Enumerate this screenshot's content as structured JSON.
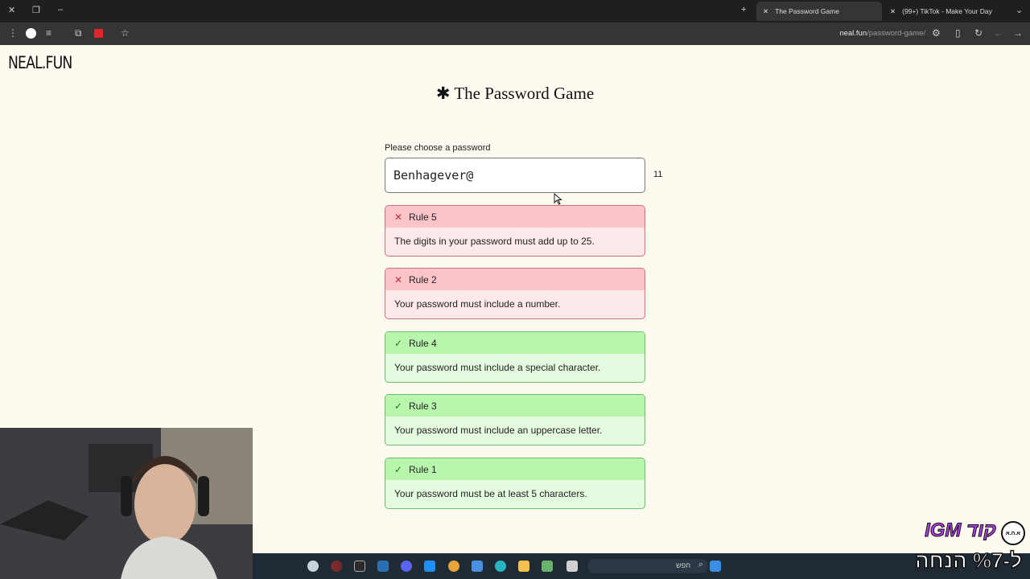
{
  "browser": {
    "tabs": [
      {
        "title": "The Password Game",
        "active": true
      },
      {
        "title": "(99+) TikTok - Make Your Day",
        "active": false
      }
    ],
    "url_host": "neal.fun",
    "url_path": "/password-game/"
  },
  "site": {
    "logo": "NEAL.FUN",
    "title": "The Password Game",
    "title_icon": "asterisk-icon"
  },
  "password": {
    "label": "Please choose a password",
    "value": "Benhagever@",
    "length": "11"
  },
  "rules": [
    {
      "name": "Rule 5",
      "text": "The digits in your password must add up to 25.",
      "status": "fail"
    },
    {
      "name": "Rule 2",
      "text": "Your password must include a number.",
      "status": "fail"
    },
    {
      "name": "Rule 4",
      "text": "Your password must include a special character.",
      "status": "pass"
    },
    {
      "name": "Rule 3",
      "text": "Your password must include an uppercase letter.",
      "status": "pass"
    },
    {
      "name": "Rule 1",
      "text": "Your password must be at least 5 characters.",
      "status": "pass"
    }
  ],
  "taskbar": {
    "search_placeholder": "חפש"
  },
  "stream_overlay": {
    "line1": "IGM קוד",
    "line2": "ל-%7 הנחה",
    "badge": "א.ה.א"
  },
  "colors": {
    "fail_header": "#fbc4c9",
    "pass_header": "#b8f5ad",
    "page_bg": "#fdfbef"
  }
}
